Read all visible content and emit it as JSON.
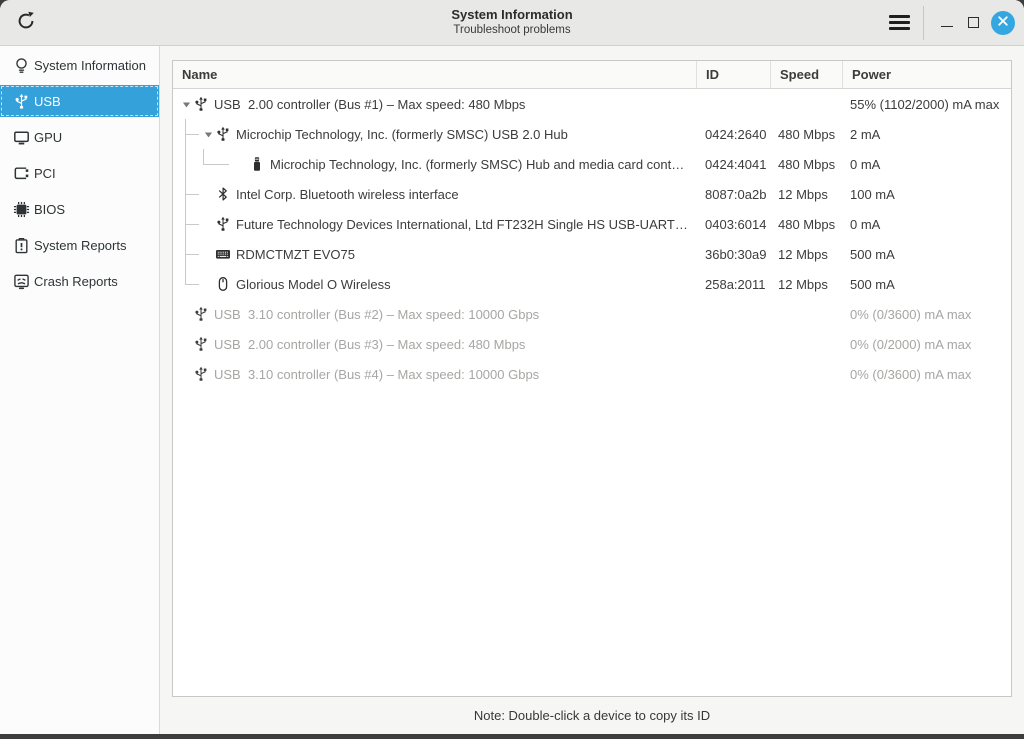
{
  "window": {
    "title": "System Information",
    "subtitle": "Troubleshoot problems",
    "titlebar_icons": [
      "refresh-icon",
      "menu-icon",
      "minimize-icon",
      "maximize-icon",
      "close-icon"
    ]
  },
  "colors": {
    "accent_selected": "#35a1da",
    "close_button": "#35a7e0",
    "titlebar_bg": "#e8e8e7",
    "dimmed_text": "#a6a6a4"
  },
  "sidebar": {
    "items": [
      {
        "label": "System Information",
        "icon": "bulb-icon",
        "selected": false
      },
      {
        "label": "USB",
        "icon": "usb-icon",
        "selected": true
      },
      {
        "label": "GPU",
        "icon": "gpu-icon",
        "selected": false
      },
      {
        "label": "PCI",
        "icon": "pci-icon",
        "selected": false
      },
      {
        "label": "BIOS",
        "icon": "bios-icon",
        "selected": false
      },
      {
        "label": "System Reports",
        "icon": "report-icon",
        "selected": false
      },
      {
        "label": "Crash Reports",
        "icon": "crash-icon",
        "selected": false
      }
    ]
  },
  "table": {
    "columns": [
      {
        "label": "Name"
      },
      {
        "label": "ID"
      },
      {
        "label": "Speed"
      },
      {
        "label": "Power"
      }
    ],
    "rows": [
      {
        "level": 0,
        "expander": true,
        "icon": "usb-icon",
        "name": "USB  2.00 controller (Bus #1) – Max speed: 480 Mbps",
        "id": "",
        "speed": "",
        "power": "55% (1102/2000) mA max",
        "dimmed": false
      },
      {
        "level": 1,
        "expander": true,
        "icon": "usb-icon",
        "name": "Microchip Technology, Inc. (formerly SMSC) USB 2.0 Hub",
        "id": "0424:2640",
        "speed": "480 Mbps",
        "power": "2 mA",
        "dimmed": false
      },
      {
        "level": 2,
        "expander": false,
        "icon": "flash-drive-icon",
        "name": "Microchip Technology, Inc. (formerly SMSC) Hub and media card cont…",
        "id": "0424:4041",
        "speed": "480 Mbps",
        "power": "0 mA",
        "dimmed": false
      },
      {
        "level": 1,
        "expander": false,
        "icon": "bluetooth-icon",
        "name": "Intel Corp. Bluetooth wireless interface",
        "id": "8087:0a2b",
        "speed": "12 Mbps",
        "power": "100 mA",
        "dimmed": false
      },
      {
        "level": 1,
        "expander": false,
        "icon": "usb-icon",
        "name": "Future Technology Devices International, Ltd FT232H Single HS USB-UART…",
        "id": "0403:6014",
        "speed": "480 Mbps",
        "power": "0 mA",
        "dimmed": false
      },
      {
        "level": 1,
        "expander": false,
        "icon": "keyboard-icon",
        "name": "RDMCTMZT EVO75",
        "id": "36b0:30a9",
        "speed": "12 Mbps",
        "power": "500 mA",
        "dimmed": false
      },
      {
        "level": 1,
        "expander": false,
        "icon": "mouse-icon",
        "name": "Glorious Model O Wireless",
        "id": "258a:2011",
        "speed": "12 Mbps",
        "power": "500 mA",
        "dimmed": false
      },
      {
        "level": 0,
        "expander": false,
        "icon": "usb-icon",
        "name": "USB  3.10 controller (Bus #2) – Max speed: 10000 Gbps",
        "id": "",
        "speed": "",
        "power": "0% (0/3600) mA max",
        "dimmed": true
      },
      {
        "level": 0,
        "expander": false,
        "icon": "usb-icon",
        "name": "USB  2.00 controller (Bus #3) – Max speed: 480 Mbps",
        "id": "",
        "speed": "",
        "power": "0% (0/2000) mA max",
        "dimmed": true
      },
      {
        "level": 0,
        "expander": false,
        "icon": "usb-icon",
        "name": "USB  3.10 controller (Bus #4) – Max speed: 10000 Gbps",
        "id": "",
        "speed": "",
        "power": "0% (0/3600) mA max",
        "dimmed": true
      }
    ]
  },
  "footer": {
    "note": "Note: Double-click a device to copy its ID"
  }
}
